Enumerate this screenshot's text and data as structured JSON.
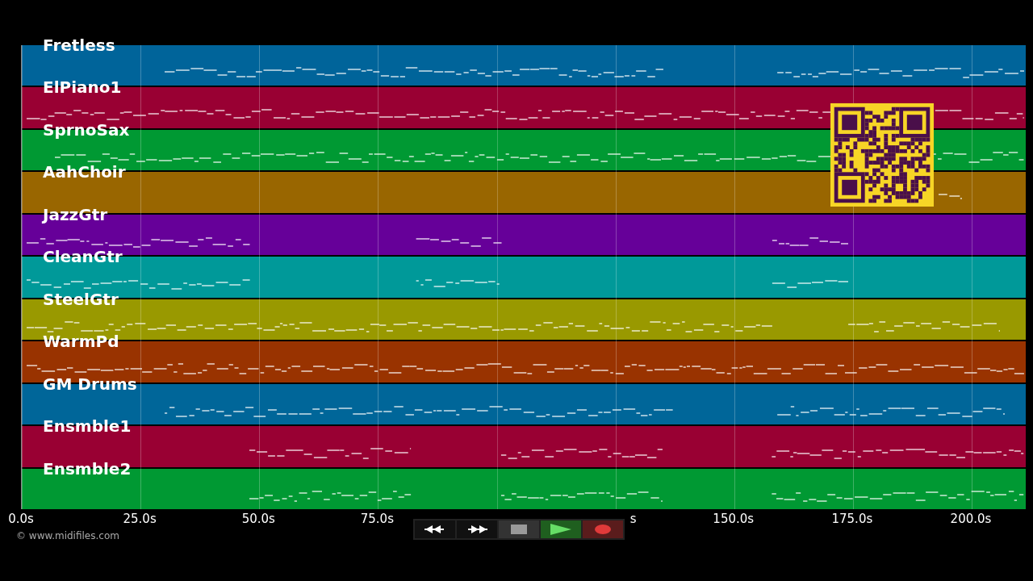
{
  "tracks": [
    {
      "name": "Fretless",
      "color": "#00649a"
    },
    {
      "name": "ElPiano1",
      "color": "#990033"
    },
    {
      "name": "SprnoSax",
      "color": "#009933"
    },
    {
      "name": "AahChoir",
      "color": "#996600"
    },
    {
      "name": "JazzGtr",
      "color": "#660099"
    },
    {
      "name": "CleanGtr",
      "color": "#009999"
    },
    {
      "name": "SteelGtr",
      "color": "#999900"
    },
    {
      "name": "WarmPd",
      "color": "#993300"
    },
    {
      "name": "GM Drums",
      "color": "#006699"
    },
    {
      "name": "Ensmble1",
      "color": "#990033"
    },
    {
      "name": "Ensmble2",
      "color": "#009933"
    }
  ],
  "axis_ticks": [
    {
      "label": "0.0s"
    },
    {
      "label": "25.0s"
    },
    {
      "label": "50.0s"
    },
    {
      "label": "75.0s"
    },
    {
      "kind": "covered"
    },
    {
      "label": "s",
      "kind": "tail"
    },
    {
      "label": "150.0s"
    },
    {
      "label": "175.0s"
    },
    {
      "label": "200.0s"
    }
  ],
  "copyright": "© www.midifiles.com",
  "transport": [
    {
      "kind": "rewind"
    },
    {
      "kind": "forward"
    },
    {
      "kind": "stop"
    },
    {
      "kind": "play"
    },
    {
      "kind": "record"
    }
  ]
}
